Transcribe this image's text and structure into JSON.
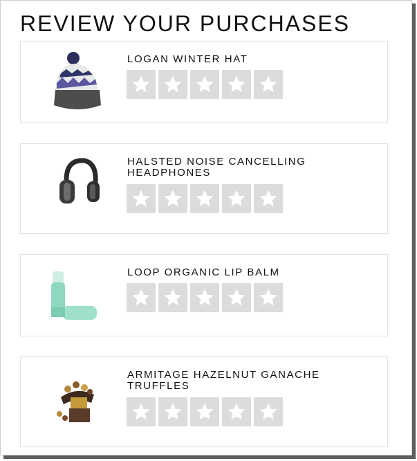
{
  "page": {
    "title": "REVIEW YOUR PURCHASES"
  },
  "products": [
    {
      "name": "LOGAN WINTER HAT",
      "image": "winter-hat-image"
    },
    {
      "name": "HALSTED NOISE CANCELLING HEADPHONES",
      "image": "headphones-image"
    },
    {
      "name": "LOOP ORGANIC LIP BALM",
      "image": "lip-balm-image"
    },
    {
      "name": "ARMITAGE HAZELNUT GANACHE TRUFFLES",
      "image": "truffles-image"
    }
  ],
  "rating": {
    "max_stars": 5,
    "current": 0,
    "star_color": "#ffffff",
    "star_bg": "#dcdcdc",
    "icon": "star-icon"
  }
}
